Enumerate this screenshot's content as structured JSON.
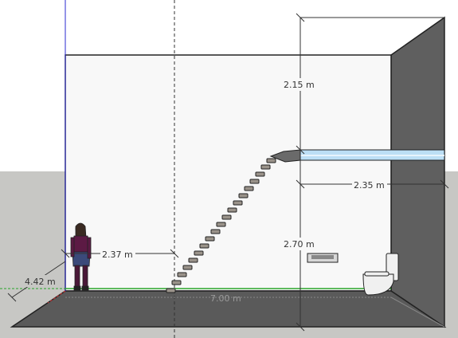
{
  "app": {
    "name": "3D modeling viewport",
    "colors": {
      "sky": "#ffffff",
      "ground": "#c7c7c4",
      "back_wall": "#f8f8f8",
      "side_wall": "#5f5f5f",
      "floor": "#5a5a5a",
      "mezzanine": "#bcdff5",
      "axis_green": "#2aa52a",
      "axis_blue": "#2a2ad0",
      "dimension_line": "#333333"
    }
  },
  "dimensions": {
    "ceiling_height": "2.15 m",
    "mezzanine_depth": "2.35 m",
    "mezzanine_height": "2.70 m",
    "stair_offset": "2.37 m",
    "room_width": "4.42 m",
    "room_length": "7.00 m"
  },
  "objects": {
    "person": "person-figure",
    "staircase": "staircase",
    "toilet": "toilet",
    "sink": "sink",
    "mezzanine": "mezzanine-platform"
  }
}
